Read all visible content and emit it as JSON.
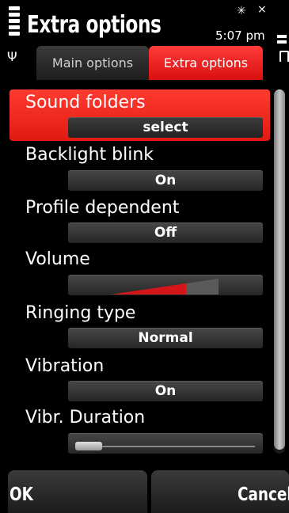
{
  "status": {
    "title": "Extra options",
    "time": "5:07 pm",
    "bluetooth_icon": "bluetooth-icon",
    "signal_icon": "signal-icon",
    "antenna_icon": "antenna-icon",
    "battery_icon": "battery-icon"
  },
  "tabs": [
    {
      "label": "Main options",
      "active": false
    },
    {
      "label": "Extra options",
      "active": true
    }
  ],
  "items": [
    {
      "label": "Sound folders",
      "value": "select"
    },
    {
      "label": "Backlight blink",
      "value": "On"
    },
    {
      "label": "Profile dependent",
      "value": "Off"
    },
    {
      "label": "Volume",
      "level": 0.7
    },
    {
      "label": "Ringing type",
      "value": "Normal"
    },
    {
      "label": "Vibration",
      "value": "On"
    },
    {
      "label": "Vibr. Duration",
      "level": 0.1
    }
  ],
  "softkeys": {
    "left": "OK",
    "right": "Cancel"
  },
  "colors": {
    "accent": "#e8241a",
    "background": "#000000",
    "field": "#3a3a3a"
  }
}
